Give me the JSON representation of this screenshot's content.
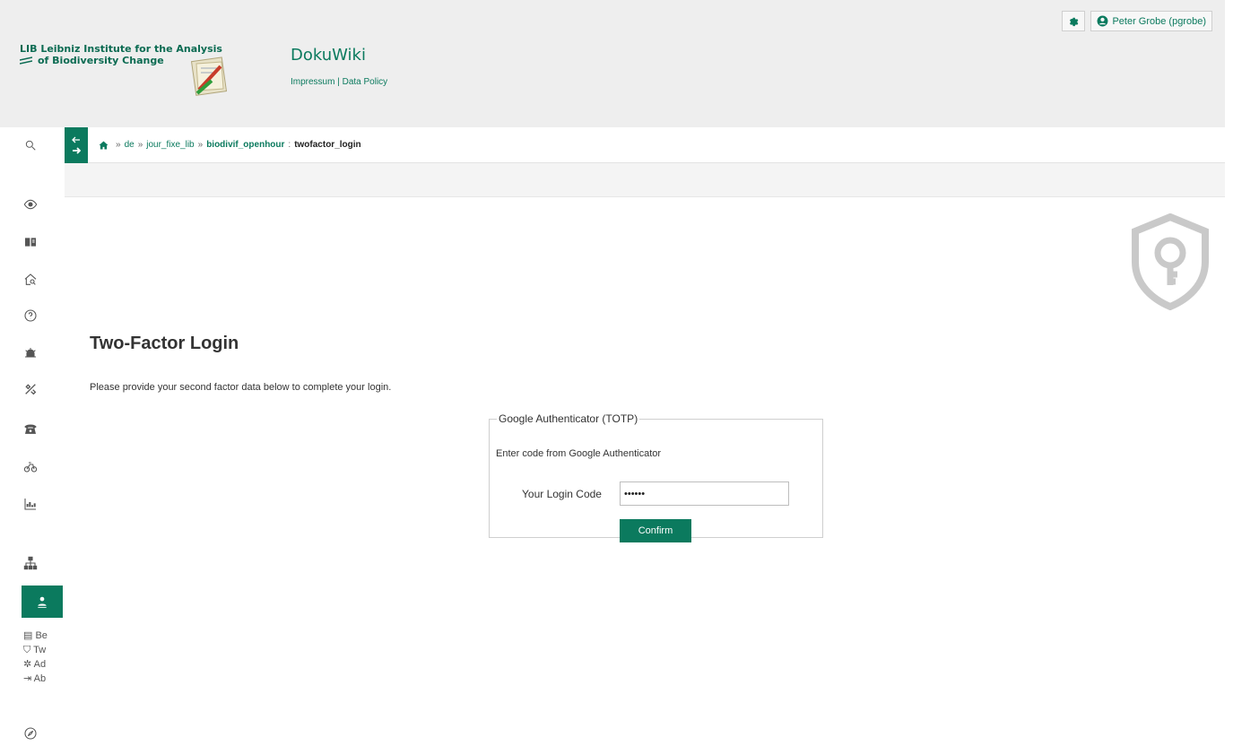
{
  "header": {
    "institute_line1": "LIB Leibniz Institute for the Analysis",
    "institute_line2": "of Biodiversity Change",
    "site_title": "DokuWiki",
    "impressum": "Impressum",
    "link_sep": " | ",
    "data_policy": "Data Policy",
    "user_name": "Peter Grobe (pgrobe)",
    "settings_icon": "gear-icon",
    "user_icon": "user-circle-icon",
    "brand_color": "#0b7a5e"
  },
  "breadcrumb": {
    "sep": "»",
    "items": [
      "de",
      "jour_fixe_lib",
      "biodivif_openhour"
    ],
    "colon": ":",
    "current": "twofactor_login"
  },
  "sidebar": {
    "icons": [
      "search-icon",
      "eye-icon",
      "book-icon",
      "home-search-icon",
      "help-icon",
      "alarm-icon",
      "tools-icon",
      "phone-icon",
      "bike-icon",
      "chart-icon",
      "sitemap-icon",
      "user-icon",
      "compass-icon"
    ],
    "sub_items": [
      "Be",
      "Tw",
      "Ad",
      "Ab"
    ]
  },
  "page": {
    "title": "Two-Factor Login",
    "intro": "Please provide your second factor data below to complete your login."
  },
  "form": {
    "legend": "Google Authenticator (TOTP)",
    "instruction": "Enter code from Google Authenticator",
    "label": "Your Login Code",
    "value": "••••••",
    "submit": "Confirm"
  }
}
